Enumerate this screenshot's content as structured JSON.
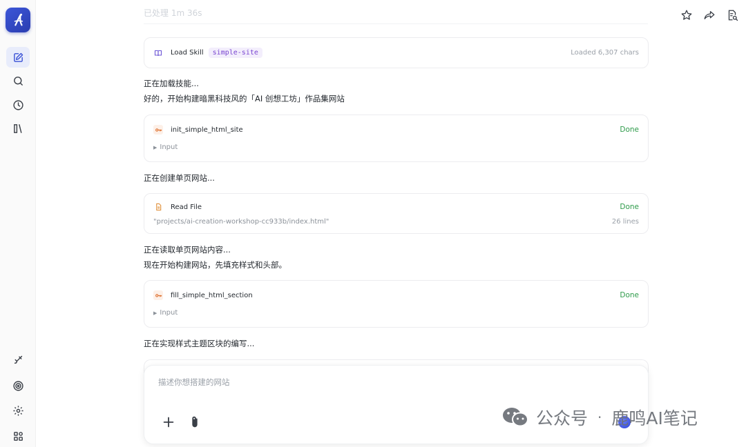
{
  "header": {
    "elapsed": "已处理 1m 36s"
  },
  "sidebar": {
    "items": [
      {
        "name": "new-chat",
        "icon": "edit-icon"
      },
      {
        "name": "search",
        "icon": "search-icon"
      },
      {
        "name": "history",
        "icon": "clock-icon"
      },
      {
        "name": "library",
        "icon": "books-icon"
      }
    ],
    "bottom": [
      {
        "name": "brush",
        "icon": "brush-icon"
      },
      {
        "name": "target",
        "icon": "target-icon"
      },
      {
        "name": "settings",
        "icon": "gear-icon"
      },
      {
        "name": "apps",
        "icon": "apps-icon"
      }
    ]
  },
  "top_actions": [
    "star-icon",
    "share-icon",
    "document-search-icon"
  ],
  "steps": {
    "load_skill": {
      "label": "Load Skill",
      "tag": "simple-site",
      "meta": "Loaded 6,307 chars"
    },
    "msg1": "正在加载技能...",
    "msg2": "好的，开始构建暗黑科技风的「AI 创想工坊」作品集网站",
    "tool1": {
      "label": "init_simple_html_site",
      "status": "Done",
      "toggle": "Input"
    },
    "msg3": "正在创建单页网站...",
    "read_file": {
      "label": "Read File",
      "status": "Done",
      "path": "\"projects/ai-creation-workshop-cc933b/index.html\"",
      "lines": "26 lines"
    },
    "msg4": "正在读取单页网站内容...",
    "msg5": "现在开始构建网站，先填充样式和头部。",
    "tool2": {
      "label": "fill_simple_html_section",
      "status": "Done",
      "toggle": "Input"
    },
    "msg6": "正在实现样式主题区块的编写..."
  },
  "composer": {
    "placeholder": "描述你想搭建的网站"
  },
  "watermark": {
    "left": "公众号",
    "sep": "·",
    "right": "鹿鸣AI笔记"
  },
  "colors": {
    "accent": "#3a52d6",
    "done": "#2e9b4a",
    "tag_text": "#7a45d1",
    "tool_icon": "#e0783a"
  }
}
